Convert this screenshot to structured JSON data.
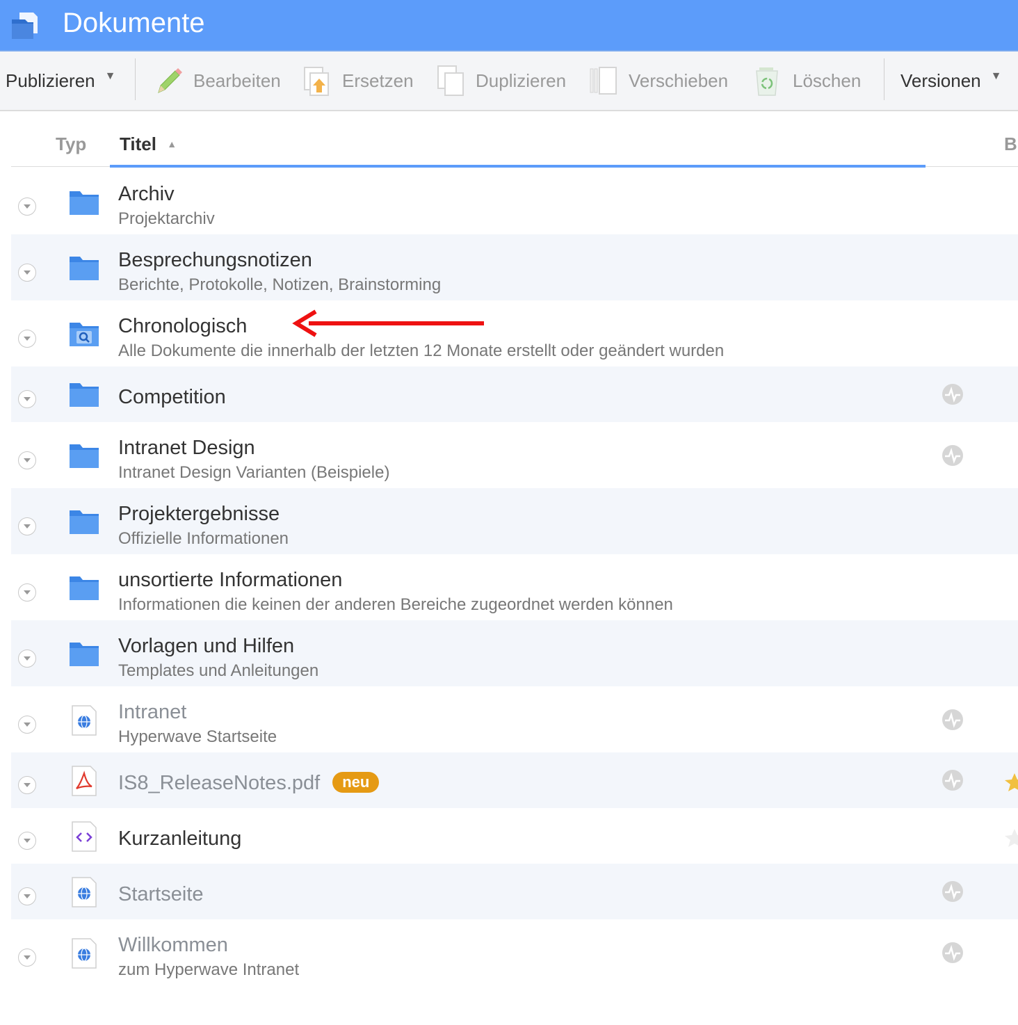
{
  "header": {
    "title": "Dokumente"
  },
  "toolbar": {
    "publizieren": "Publizieren",
    "bearbeiten": "Bearbeiten",
    "ersetzen": "Ersetzen",
    "duplizieren": "Duplizieren",
    "verschieben": "Verschieben",
    "loeschen": "Löschen",
    "versionen": "Versionen"
  },
  "columns": {
    "typ": "Typ",
    "titel": "Titel",
    "b": "B"
  },
  "rows": [
    {
      "title": "Archiv",
      "subtitle": "Projektarchiv",
      "icon": "folder-icon"
    },
    {
      "title": "Besprechungsnotizen",
      "subtitle": "Berichte, Protokolle, Notizen, Brainstorming",
      "icon": "folder-icon"
    },
    {
      "title": "Chronologisch",
      "subtitle": "Alle Dokumente die innerhalb der letzten 12 Monate erstellt oder geändert wurden",
      "icon": "search-folder-icon"
    },
    {
      "title": "Competition",
      "subtitle": "",
      "icon": "folder-icon"
    },
    {
      "title": "Intranet Design",
      "subtitle": "Intranet Design Varianten (Beispiele)",
      "icon": "folder-icon"
    },
    {
      "title": "Projektergebnisse",
      "subtitle": "Offizielle Informationen",
      "icon": "folder-icon"
    },
    {
      "title": "unsortierte Informationen",
      "subtitle": "Informationen die keinen der anderen Bereiche zugeordnet werden können",
      "icon": "folder-icon"
    },
    {
      "title": "Vorlagen und Hilfen",
      "subtitle": "Templates und Anleitungen",
      "icon": "folder-icon"
    },
    {
      "title": "Intranet",
      "subtitle": "Hyperwave Startseite",
      "icon": "web-page-icon"
    },
    {
      "title": "IS8_ReleaseNotes.pdf",
      "subtitle": "",
      "badge": "neu",
      "icon": "pdf-icon"
    },
    {
      "title": "Kurzanleitung",
      "subtitle": "",
      "icon": "code-file-icon"
    },
    {
      "title": "Startseite",
      "subtitle": "",
      "icon": "web-page-icon"
    },
    {
      "title": "Willkommen",
      "subtitle": "zum Hyperwave Intranet",
      "icon": "web-page-icon"
    }
  ],
  "colors": {
    "header": "#5c9cfa",
    "accent": "#5c9cfa",
    "folder": "#5a9ef2",
    "badge": "#e59a14",
    "annotation_arrow": "#ee1111"
  }
}
